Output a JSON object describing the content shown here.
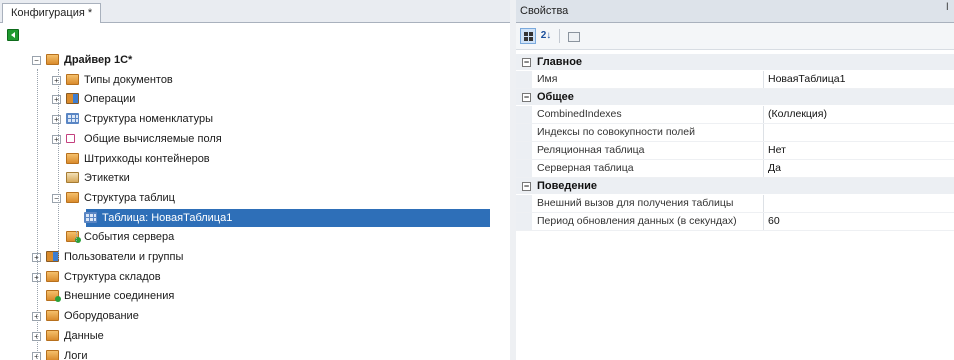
{
  "left_panel": {
    "tab_title": "Конфигурация *",
    "tree": [
      {
        "label": "Драйвер 1С*",
        "icon": "folder-icon",
        "level": 0,
        "expander": "−",
        "bold": true
      },
      {
        "label": "Типы документов",
        "icon": "folder-icon",
        "level": 1,
        "expander": "+"
      },
      {
        "label": "Операции",
        "icon": "folder-mix-icon",
        "level": 1,
        "expander": "+"
      },
      {
        "label": "Структура номенклатуры",
        "icon": "table-icon",
        "level": 1,
        "expander": "+"
      },
      {
        "label": "Общие вычисляемые поля",
        "icon": "fields-icon",
        "level": 1,
        "expander": "+"
      },
      {
        "label": "Штрихкоды контейнеров",
        "icon": "folder-icon",
        "level": 1,
        "expander": ""
      },
      {
        "label": "Этикетки",
        "icon": "label-icon",
        "level": 1,
        "expander": ""
      },
      {
        "label": "Структура таблиц",
        "icon": "folder-icon",
        "level": 1,
        "expander": "−"
      },
      {
        "label": "Таблица: НоваяТаблица1",
        "icon": "table-icon",
        "level": 2,
        "expander": "",
        "selected": true
      },
      {
        "label": "События сервера",
        "icon": "event-icon",
        "level": 1,
        "expander": ""
      },
      {
        "label": "Пользователи и группы",
        "icon": "folder-mix-icon",
        "level": 0,
        "expander": "+"
      },
      {
        "label": "Структура складов",
        "icon": "folder-icon",
        "level": 0,
        "expander": "+"
      },
      {
        "label": "Внешние соединения",
        "icon": "event-icon",
        "level": 0,
        "expander": ""
      },
      {
        "label": "Оборудование",
        "icon": "folder-icon",
        "level": 0,
        "expander": "+"
      },
      {
        "label": "Данные",
        "icon": "folder-icon",
        "level": 0,
        "expander": "+"
      },
      {
        "label": "Логи",
        "icon": "folder-icon",
        "level": 0,
        "expander": "+"
      }
    ]
  },
  "right_panel": {
    "title": "Свойства",
    "pin_glyph": "ǀ",
    "toolbar": {
      "categorized_icon": "categorized-icon",
      "alphabetical_label": "2↓",
      "property_pages_icon": "property-pages-icon"
    },
    "sections": [
      {
        "title": "Главное",
        "props": [
          {
            "name": "Имя",
            "value": "НоваяТаблица1"
          }
        ]
      },
      {
        "title": "Общее",
        "props": [
          {
            "name": "CombinedIndexes",
            "value": "(Коллекция)"
          },
          {
            "name": "Индексы по совокупности полей",
            "value": ""
          },
          {
            "name": "Реляционная таблица",
            "value": "Нет"
          },
          {
            "name": "Серверная таблица",
            "value": "Да"
          }
        ]
      },
      {
        "title": "Поведение",
        "props": [
          {
            "name": "Внешний вызов для получения таблицы",
            "value": ""
          },
          {
            "name": "Период обновления данных (в секундах)",
            "value": "60"
          }
        ]
      }
    ]
  },
  "colors": {
    "selection": "#2e6fb8",
    "folder": "#d98b2c",
    "back_button": "#1f9a2f"
  }
}
